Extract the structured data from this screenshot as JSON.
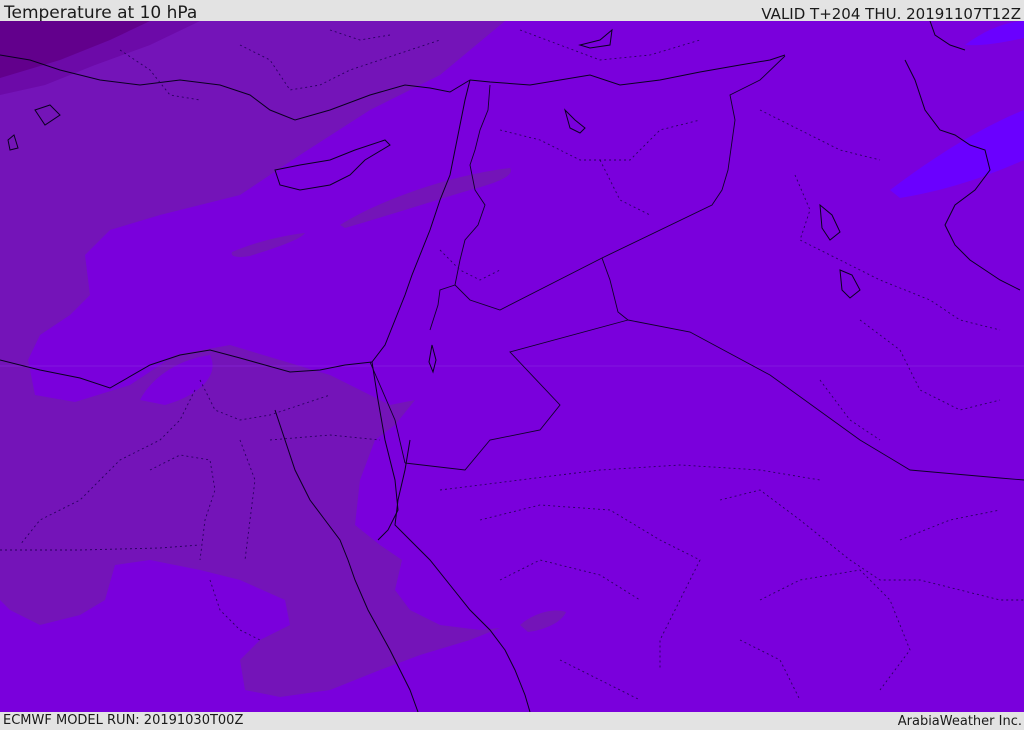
{
  "header": {
    "title": "Temperature at 10 hPa",
    "valid_time": "VALID T+204 THU. 20191107T12Z"
  },
  "footer": {
    "model_run": "ECMWF MODEL RUN: 20191030T00Z",
    "credit": "ArabiaWeather Inc."
  },
  "colors": {
    "background_band": "#e3e3e3",
    "field_main": "#7a00dc",
    "field_warm": "#7414b8",
    "field_warmer": "#6c0aa8",
    "field_warmest": "#62008c",
    "field_cold": "#6a00ff",
    "coastline": "#000000",
    "border_dotted": "#2a0060"
  }
}
